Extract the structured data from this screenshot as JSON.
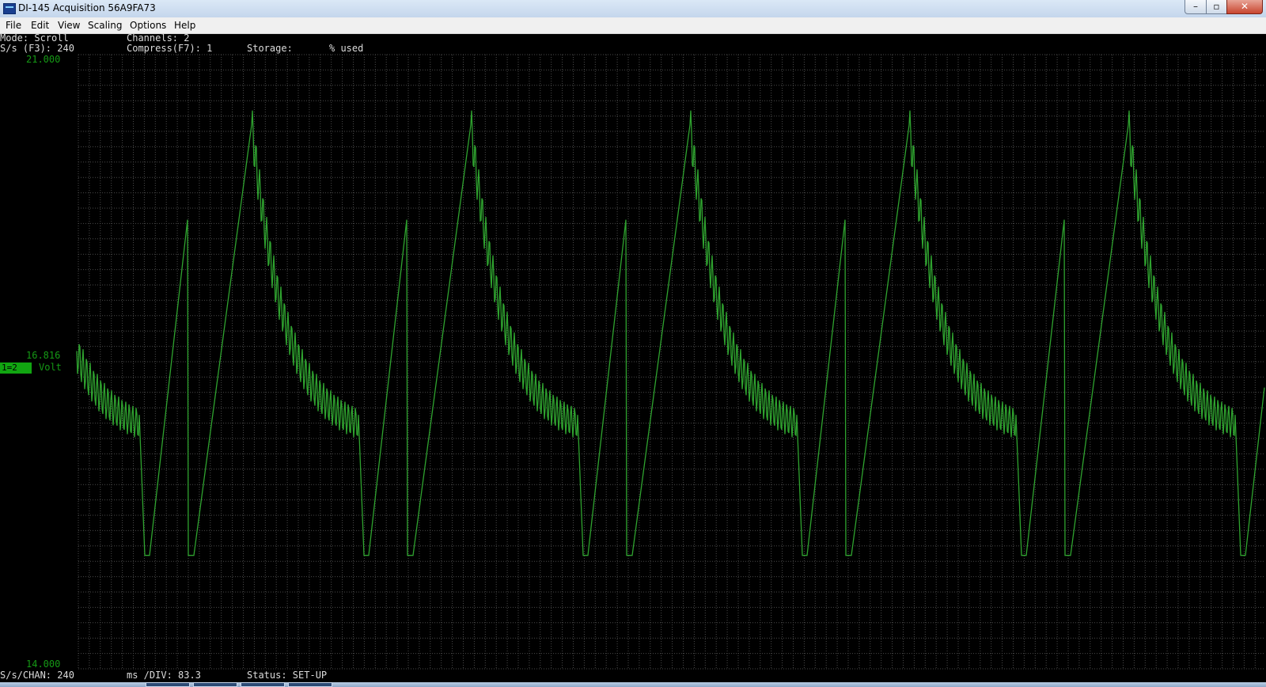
{
  "window": {
    "title": "DI-145 Acquisition 56A9FA73"
  },
  "menu": [
    "File",
    "Edit",
    "View",
    "Scaling",
    "Options",
    "Help"
  ],
  "header": {
    "line1_left": "Mode: Scroll",
    "line1_mid": "Channels: 2",
    "line2_left": "S/s (F3): 240",
    "line2_mid": "Compress(F7): 1",
    "line2_storage": "Storage:",
    "line2_used": "% used"
  },
  "scale": {
    "top": "21.000",
    "mid": "16.816",
    "bottom": "14.000",
    "channel_tag": "1=2",
    "unit": "Volt"
  },
  "footer": {
    "sps_chan": "S/s/CHAN: 240",
    "ms_div": "ms /DIV: 83.3",
    "status": "Status: SET-UP"
  },
  "chart_data": {
    "type": "line",
    "ylim": [
      14.0,
      21.0
    ],
    "grid": true,
    "series": [
      {
        "color": "#2fa32f",
        "shape": "sawtooth with ringing",
        "cycle_period_samples": 100,
        "peak_volts": 20.2,
        "trough_volts": 15.3,
        "mid_volts": 16.9,
        "cycles_visible": 5.5
      }
    ]
  }
}
